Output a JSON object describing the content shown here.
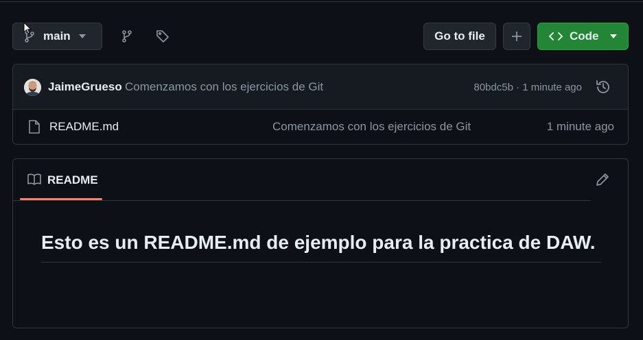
{
  "toolbar": {
    "branch_label": "main",
    "branch_icon": "git-branch-icon",
    "branches_icon": "git-branch-icon",
    "tags_icon": "tag-icon",
    "go_to_file_label": "Go to file",
    "add_icon": "plus-icon",
    "code_label": "Code",
    "code_icon": "code-icon"
  },
  "latest_commit": {
    "author": "JaimeGrueso",
    "message": "Comenzamos con los ejercicios de Git",
    "meta": "80bdc5b · 1 minute ago",
    "history_icon": "history-icon"
  },
  "files": [
    {
      "name": "README.md",
      "icon": "file-icon",
      "commit_message": "Comenzamos con los ejercicios de Git",
      "time": "1 minute ago"
    }
  ],
  "readme": {
    "tab_label": "README",
    "tab_icon": "book-icon",
    "edit_icon": "pencil-icon",
    "heading": "Esto es un README.md de ejemplo para la practica de DAW."
  },
  "colors": {
    "background": "#0d1117",
    "code_button": "#238636",
    "active_tab_underline": "#f78166"
  }
}
